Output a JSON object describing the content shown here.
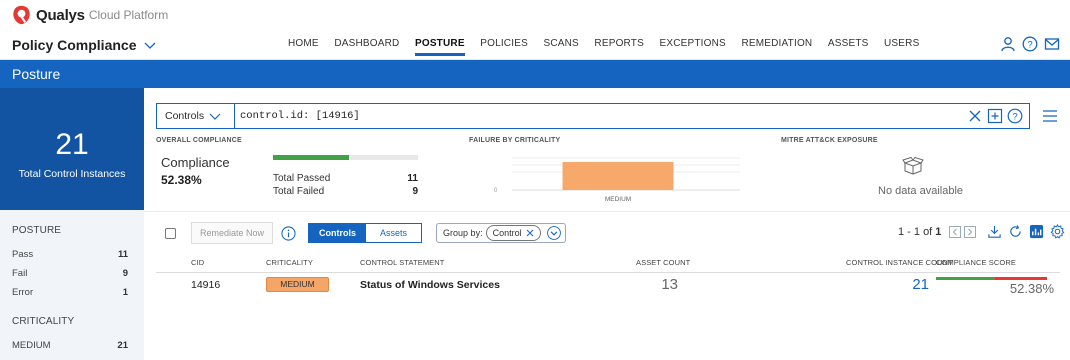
{
  "brand": {
    "name": "Qualys",
    "suffix": "Cloud Platform"
  },
  "module": {
    "label": "Policy Compliance"
  },
  "nav": {
    "items": [
      "HOME",
      "DASHBOARD",
      "POSTURE",
      "POLICIES",
      "SCANS",
      "REPORTS",
      "EXCEPTIONS",
      "REMEDIATION",
      "ASSETS",
      "USERS"
    ],
    "active": "POSTURE"
  },
  "header_icons": [
    "user-icon",
    "help-icon",
    "mail-icon"
  ],
  "page_title": "Posture",
  "left": {
    "total_count": "21",
    "total_label": "Total Control Instances",
    "posture_title": "POSTURE",
    "posture": [
      {
        "label": "Pass",
        "value": "11"
      },
      {
        "label": "Fail",
        "value": "9"
      },
      {
        "label": "Error",
        "value": "1"
      }
    ],
    "criticality_title": "CRITICALITY",
    "criticality": [
      {
        "label": "MEDIUM",
        "value": "21"
      }
    ]
  },
  "search": {
    "scope": "Controls",
    "query": "control.id: [14916]"
  },
  "summary": {
    "overall_title": "OVERALL COMPLIANCE",
    "compliance_label": "Compliance",
    "compliance_value": "52.38%",
    "compliance_fraction": 0.5238,
    "passed_label": "Total Passed",
    "passed_value": "11",
    "failed_label": "Total Failed",
    "failed_value": "9",
    "failure_title": "FAILURE BY CRITICALITY",
    "mitre_title": "MITRE ATT&CK EXPOSURE",
    "mitre_empty": "No data available"
  },
  "failure_chart": {
    "type": "bar",
    "categories": [
      "MEDIUM"
    ],
    "values": [
      9
    ],
    "y_tick": "0",
    "color": "#f7a96c"
  },
  "toolbar": {
    "remediate_label": "Remediate Now",
    "view_controls": "Controls",
    "view_assets": "Assets",
    "group_by_label": "Group by:",
    "group_by_value": "Control"
  },
  "pager": {
    "text": "1 - 1 of",
    "total": "1"
  },
  "table": {
    "headers": {
      "cid": "CID",
      "criticality": "CRITICALITY",
      "statement": "CONTROL STATEMENT",
      "asset_count": "ASSET COUNT",
      "instance_count": "CONTROL INSTANCE COUNT",
      "score": "COMPLIANCE SCORE"
    },
    "rows": [
      {
        "cid": "14916",
        "criticality": "MEDIUM",
        "statement": "Status of Windows Services",
        "asset_count": "13",
        "instance_count": "21",
        "score": "52.38%",
        "score_fraction": 0.5238
      }
    ]
  },
  "colors": {
    "primary": "#1565c0",
    "dark_panel": "#1254a1",
    "pass": "#43a047",
    "fail": "#e53935",
    "medium": "#f4a669"
  }
}
